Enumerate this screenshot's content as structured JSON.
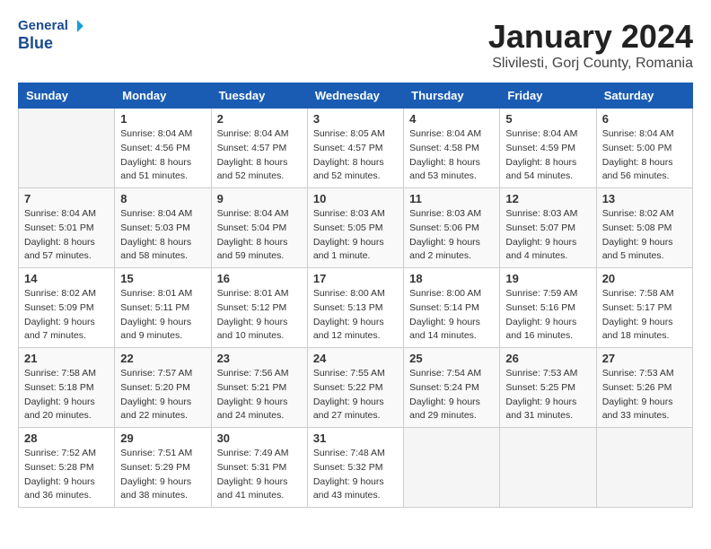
{
  "header": {
    "logo_general": "General",
    "logo_blue": "Blue",
    "title": "January 2024",
    "location": "Slivilesti, Gorj County, Romania"
  },
  "weekdays": [
    "Sunday",
    "Monday",
    "Tuesday",
    "Wednesday",
    "Thursday",
    "Friday",
    "Saturday"
  ],
  "weeks": [
    [
      {
        "day": "",
        "sunrise": "",
        "sunset": "",
        "daylight": ""
      },
      {
        "day": "1",
        "sunrise": "Sunrise: 8:04 AM",
        "sunset": "Sunset: 4:56 PM",
        "daylight": "Daylight: 8 hours and 51 minutes."
      },
      {
        "day": "2",
        "sunrise": "Sunrise: 8:04 AM",
        "sunset": "Sunset: 4:57 PM",
        "daylight": "Daylight: 8 hours and 52 minutes."
      },
      {
        "day": "3",
        "sunrise": "Sunrise: 8:05 AM",
        "sunset": "Sunset: 4:57 PM",
        "daylight": "Daylight: 8 hours and 52 minutes."
      },
      {
        "day": "4",
        "sunrise": "Sunrise: 8:04 AM",
        "sunset": "Sunset: 4:58 PM",
        "daylight": "Daylight: 8 hours and 53 minutes."
      },
      {
        "day": "5",
        "sunrise": "Sunrise: 8:04 AM",
        "sunset": "Sunset: 4:59 PM",
        "daylight": "Daylight: 8 hours and 54 minutes."
      },
      {
        "day": "6",
        "sunrise": "Sunrise: 8:04 AM",
        "sunset": "Sunset: 5:00 PM",
        "daylight": "Daylight: 8 hours and 56 minutes."
      }
    ],
    [
      {
        "day": "7",
        "sunrise": "Sunrise: 8:04 AM",
        "sunset": "Sunset: 5:01 PM",
        "daylight": "Daylight: 8 hours and 57 minutes."
      },
      {
        "day": "8",
        "sunrise": "Sunrise: 8:04 AM",
        "sunset": "Sunset: 5:03 PM",
        "daylight": "Daylight: 8 hours and 58 minutes."
      },
      {
        "day": "9",
        "sunrise": "Sunrise: 8:04 AM",
        "sunset": "Sunset: 5:04 PM",
        "daylight": "Daylight: 8 hours and 59 minutes."
      },
      {
        "day": "10",
        "sunrise": "Sunrise: 8:03 AM",
        "sunset": "Sunset: 5:05 PM",
        "daylight": "Daylight: 9 hours and 1 minute."
      },
      {
        "day": "11",
        "sunrise": "Sunrise: 8:03 AM",
        "sunset": "Sunset: 5:06 PM",
        "daylight": "Daylight: 9 hours and 2 minutes."
      },
      {
        "day": "12",
        "sunrise": "Sunrise: 8:03 AM",
        "sunset": "Sunset: 5:07 PM",
        "daylight": "Daylight: 9 hours and 4 minutes."
      },
      {
        "day": "13",
        "sunrise": "Sunrise: 8:02 AM",
        "sunset": "Sunset: 5:08 PM",
        "daylight": "Daylight: 9 hours and 5 minutes."
      }
    ],
    [
      {
        "day": "14",
        "sunrise": "Sunrise: 8:02 AM",
        "sunset": "Sunset: 5:09 PM",
        "daylight": "Daylight: 9 hours and 7 minutes."
      },
      {
        "day": "15",
        "sunrise": "Sunrise: 8:01 AM",
        "sunset": "Sunset: 5:11 PM",
        "daylight": "Daylight: 9 hours and 9 minutes."
      },
      {
        "day": "16",
        "sunrise": "Sunrise: 8:01 AM",
        "sunset": "Sunset: 5:12 PM",
        "daylight": "Daylight: 9 hours and 10 minutes."
      },
      {
        "day": "17",
        "sunrise": "Sunrise: 8:00 AM",
        "sunset": "Sunset: 5:13 PM",
        "daylight": "Daylight: 9 hours and 12 minutes."
      },
      {
        "day": "18",
        "sunrise": "Sunrise: 8:00 AM",
        "sunset": "Sunset: 5:14 PM",
        "daylight": "Daylight: 9 hours and 14 minutes."
      },
      {
        "day": "19",
        "sunrise": "Sunrise: 7:59 AM",
        "sunset": "Sunset: 5:16 PM",
        "daylight": "Daylight: 9 hours and 16 minutes."
      },
      {
        "day": "20",
        "sunrise": "Sunrise: 7:58 AM",
        "sunset": "Sunset: 5:17 PM",
        "daylight": "Daylight: 9 hours and 18 minutes."
      }
    ],
    [
      {
        "day": "21",
        "sunrise": "Sunrise: 7:58 AM",
        "sunset": "Sunset: 5:18 PM",
        "daylight": "Daylight: 9 hours and 20 minutes."
      },
      {
        "day": "22",
        "sunrise": "Sunrise: 7:57 AM",
        "sunset": "Sunset: 5:20 PM",
        "daylight": "Daylight: 9 hours and 22 minutes."
      },
      {
        "day": "23",
        "sunrise": "Sunrise: 7:56 AM",
        "sunset": "Sunset: 5:21 PM",
        "daylight": "Daylight: 9 hours and 24 minutes."
      },
      {
        "day": "24",
        "sunrise": "Sunrise: 7:55 AM",
        "sunset": "Sunset: 5:22 PM",
        "daylight": "Daylight: 9 hours and 27 minutes."
      },
      {
        "day": "25",
        "sunrise": "Sunrise: 7:54 AM",
        "sunset": "Sunset: 5:24 PM",
        "daylight": "Daylight: 9 hours and 29 minutes."
      },
      {
        "day": "26",
        "sunrise": "Sunrise: 7:53 AM",
        "sunset": "Sunset: 5:25 PM",
        "daylight": "Daylight: 9 hours and 31 minutes."
      },
      {
        "day": "27",
        "sunrise": "Sunrise: 7:53 AM",
        "sunset": "Sunset: 5:26 PM",
        "daylight": "Daylight: 9 hours and 33 minutes."
      }
    ],
    [
      {
        "day": "28",
        "sunrise": "Sunrise: 7:52 AM",
        "sunset": "Sunset: 5:28 PM",
        "daylight": "Daylight: 9 hours and 36 minutes."
      },
      {
        "day": "29",
        "sunrise": "Sunrise: 7:51 AM",
        "sunset": "Sunset: 5:29 PM",
        "daylight": "Daylight: 9 hours and 38 minutes."
      },
      {
        "day": "30",
        "sunrise": "Sunrise: 7:49 AM",
        "sunset": "Sunset: 5:31 PM",
        "daylight": "Daylight: 9 hours and 41 minutes."
      },
      {
        "day": "31",
        "sunrise": "Sunrise: 7:48 AM",
        "sunset": "Sunset: 5:32 PM",
        "daylight": "Daylight: 9 hours and 43 minutes."
      },
      {
        "day": "",
        "sunrise": "",
        "sunset": "",
        "daylight": ""
      },
      {
        "day": "",
        "sunrise": "",
        "sunset": "",
        "daylight": ""
      },
      {
        "day": "",
        "sunrise": "",
        "sunset": "",
        "daylight": ""
      }
    ]
  ]
}
